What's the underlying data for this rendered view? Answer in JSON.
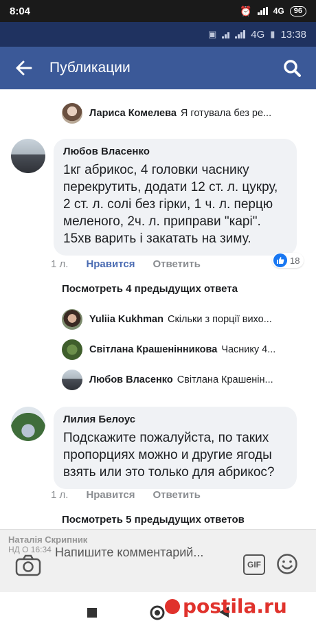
{
  "status_bar": {
    "time": "8:04",
    "network": "4G",
    "battery": "96"
  },
  "inner_status": {
    "network": "4G",
    "time": "13:38"
  },
  "header": {
    "title": "Публикации",
    "back_icon": "arrow-left-icon",
    "search_icon": "search-icon"
  },
  "replies_top": [
    {
      "name": "Лариса Комелева",
      "text": "Я готувала без ре..."
    }
  ],
  "comments": [
    {
      "name": "Любов Власенко",
      "text": "1кг абрикос, 4 головки часнику перекрутить, додати 12 ст. л. цукру, 2 ст. л. солі без гірки, 1 ч. л. перцю меленого, 2ч. л. приправи \"карі\". 15хв варить і закатать на зиму.",
      "age": "1 л.",
      "like_label": "Нравится",
      "reply_label": "Ответить",
      "reactions": "18",
      "view_more": "Посмотреть 4 предыдущих ответа",
      "replies": [
        {
          "name": "Yuliia Kukhman",
          "text": "Скільки з порції вихо..."
        },
        {
          "name": "Світлана Крашенінникова",
          "text": "Часнику 4..."
        },
        {
          "name": "Любов Власенко",
          "text": "Світлана Крашенін..."
        }
      ]
    },
    {
      "name": "Лилия Белоус",
      "text": "Подскажите пожалуйста, по таких пропорциях можно и другие ягоды взять или это только для абрикос?",
      "age": "1 л.",
      "like_label": "Нравится",
      "reply_label": "Ответить",
      "view_more": "Посмотреть 5 предыдущих ответов"
    }
  ],
  "composer": {
    "placeholder": "Напишите комментарий...",
    "gif_label": "GIF",
    "overlay_name": "Наталія Скрипник",
    "overlay_date": "НД О 16:34"
  },
  "watermark": {
    "text": "postila.ru"
  },
  "colors": {
    "header": "#3b5998",
    "accent": "#4a6bb2",
    "like_blue": "#1877f2",
    "watermark": "#e0322c"
  }
}
